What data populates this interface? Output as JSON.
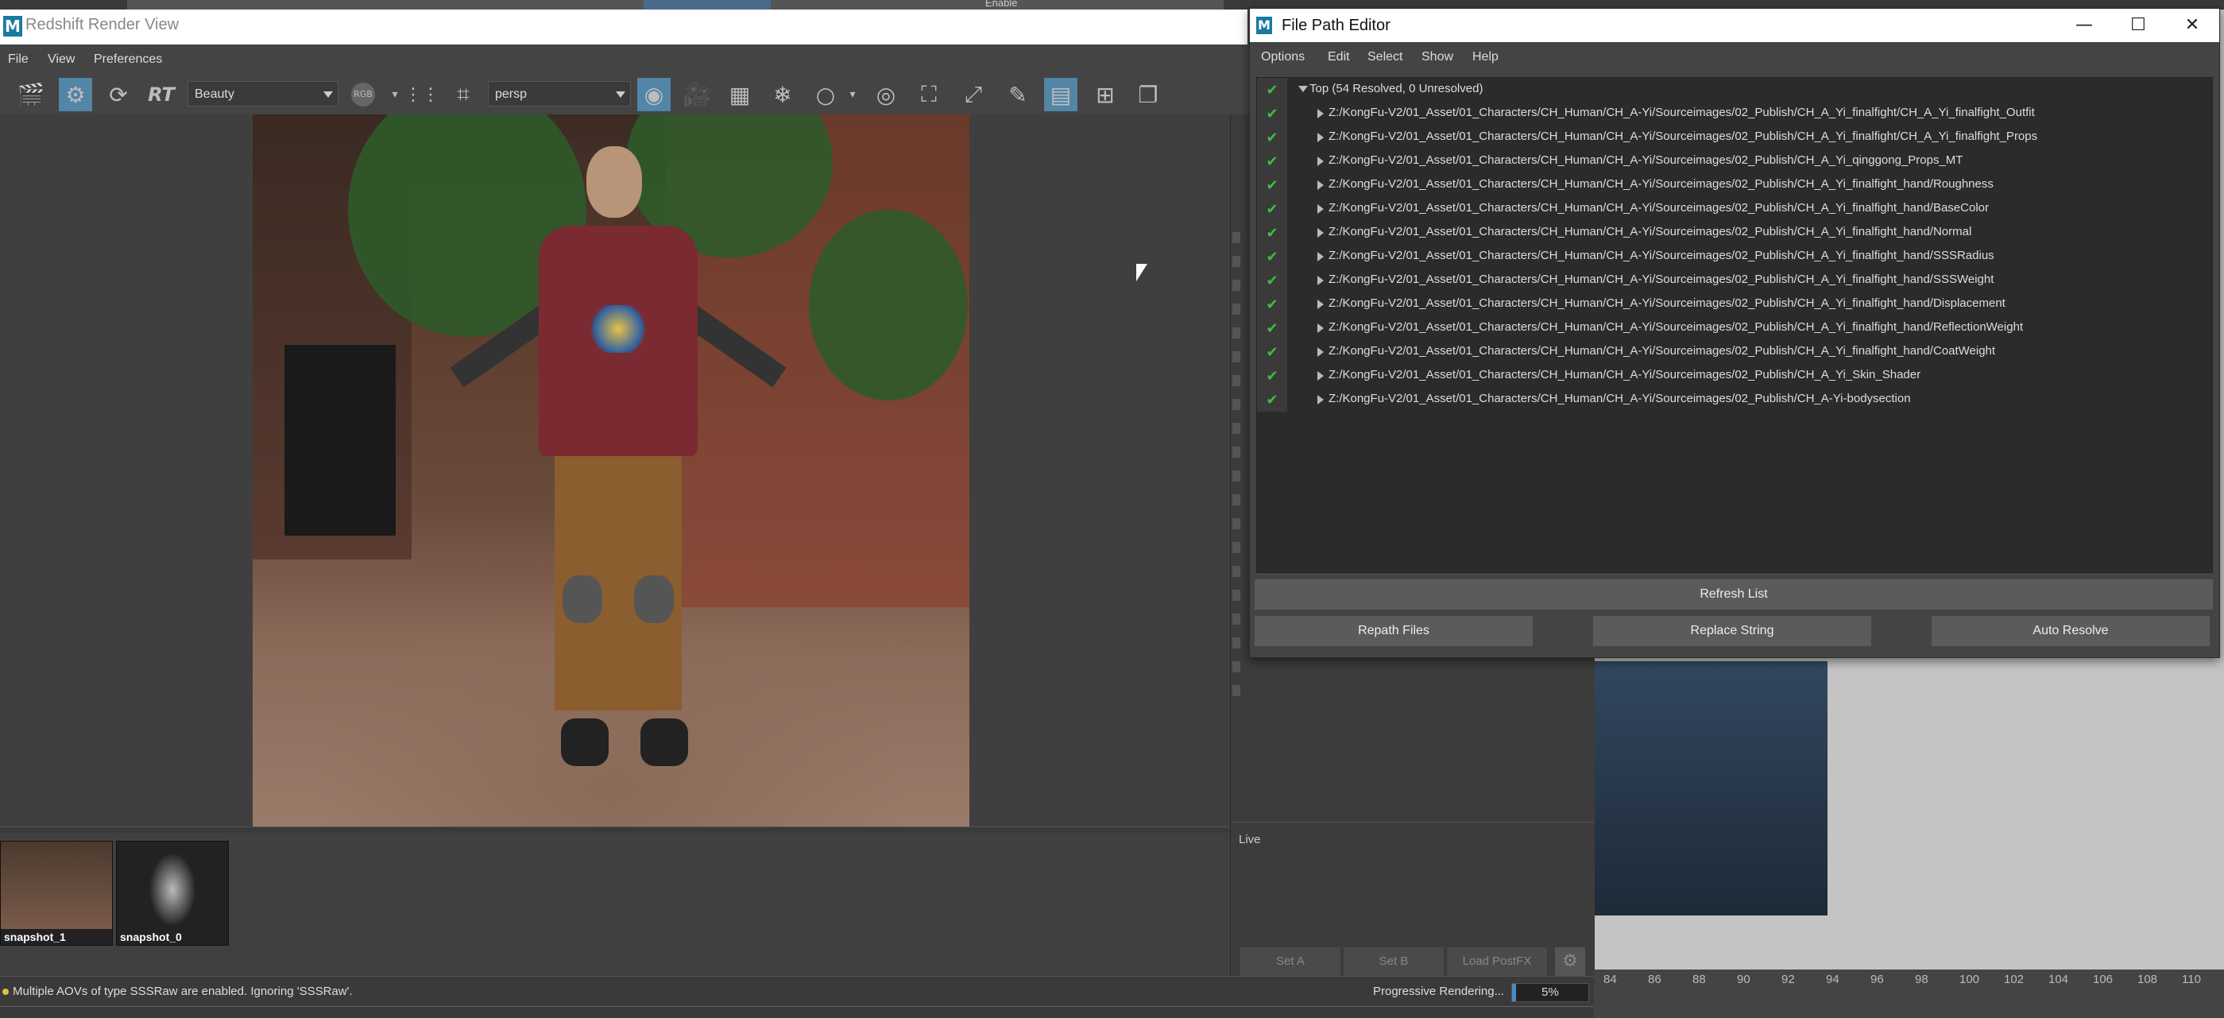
{
  "background_window": {
    "enable_label": "Enable"
  },
  "redshift": {
    "title": "Redshift Render View",
    "app_icon": "M",
    "menu": [
      "File",
      "View",
      "Preferences"
    ],
    "aov_dropdown": "Beauty",
    "channel_badge": "RGB",
    "rt_label": "RT",
    "camera_dropdown": "persp",
    "snapshots": [
      {
        "label": "snapshot_1"
      },
      {
        "label": "snapshot_0"
      }
    ],
    "status_message": "Multiple AOVs of type SSSRaw are enabled. Ignoring 'SSSRaw'.",
    "progress_label": "Progressive Rendering...",
    "progress_percent": "5%",
    "progress_fraction": 0.05
  },
  "side_panel": {
    "live_label": "Live",
    "buttons": [
      "Set A",
      "Set B",
      "Load PostFX"
    ]
  },
  "timeline": {
    "ticks": [
      "84",
      "86",
      "88",
      "90",
      "92",
      "94",
      "96",
      "98",
      "100",
      "102",
      "104",
      "106",
      "108",
      "110"
    ]
  },
  "file_path_editor": {
    "title": "File Path Editor",
    "app_icon": "M",
    "menu": [
      "Options",
      "Edit",
      "Select",
      "Show",
      "Help"
    ],
    "root_label": "Top (54 Resolved, 0 Unresolved)",
    "paths": [
      "Z:/KongFu-V2/01_Asset/01_Characters/CH_Human/CH_A-Yi/Sourceimages/02_Publish/CH_A_Yi_finalfight/CH_A_Yi_finalfight_Outfit",
      "Z:/KongFu-V2/01_Asset/01_Characters/CH_Human/CH_A-Yi/Sourceimages/02_Publish/CH_A_Yi_finalfight/CH_A_Yi_finalfight_Props",
      "Z:/KongFu-V2/01_Asset/01_Characters/CH_Human/CH_A-Yi/Sourceimages/02_Publish/CH_A_Yi_qinggong_Props_MT",
      "Z:/KongFu-V2/01_Asset/01_Characters/CH_Human/CH_A-Yi/Sourceimages/02_Publish/CH_A_Yi_finalfight_hand/Roughness",
      "Z:/KongFu-V2/01_Asset/01_Characters/CH_Human/CH_A-Yi/Sourceimages/02_Publish/CH_A_Yi_finalfight_hand/BaseColor",
      "Z:/KongFu-V2/01_Asset/01_Characters/CH_Human/CH_A-Yi/Sourceimages/02_Publish/CH_A_Yi_finalfight_hand/Normal",
      "Z:/KongFu-V2/01_Asset/01_Characters/CH_Human/CH_A-Yi/Sourceimages/02_Publish/CH_A_Yi_finalfight_hand/SSSRadius",
      "Z:/KongFu-V2/01_Asset/01_Characters/CH_Human/CH_A-Yi/Sourceimages/02_Publish/CH_A_Yi_finalfight_hand/SSSWeight",
      "Z:/KongFu-V2/01_Asset/01_Characters/CH_Human/CH_A-Yi/Sourceimages/02_Publish/CH_A_Yi_finalfight_hand/Displacement",
      "Z:/KongFu-V2/01_Asset/01_Characters/CH_Human/CH_A-Yi/Sourceimages/02_Publish/CH_A_Yi_finalfight_hand/ReflectionWeight",
      "Z:/KongFu-V2/01_Asset/01_Characters/CH_Human/CH_A-Yi/Sourceimages/02_Publish/CH_A_Yi_finalfight_hand/CoatWeight",
      "Z:/KongFu-V2/01_Asset/01_Characters/CH_Human/CH_A-Yi/Sourceimages/02_Publish/CH_A_Yi_Skin_Shader",
      "Z:/KongFu-V2/01_Asset/01_Characters/CH_Human/CH_A-Yi/Sourceimages/02_Publish/CH_A-Yi-bodysection"
    ],
    "buttons": {
      "refresh": "Refresh List",
      "repath": "Repath Files",
      "replace": "Replace String",
      "auto_resolve": "Auto Resolve"
    },
    "window_controls": {
      "minimize": "—",
      "maximize": "☐",
      "close": "✕"
    }
  },
  "colors": {
    "accent": "#5285a6",
    "check": "#3fbd3f",
    "progress": "#4a8ac0"
  }
}
